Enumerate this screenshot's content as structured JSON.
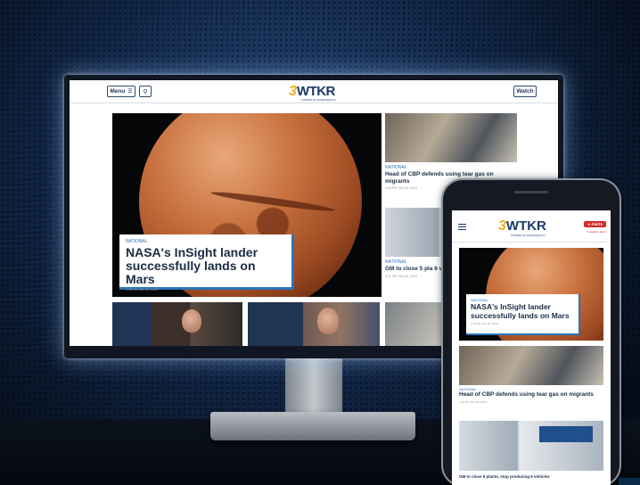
{
  "desktop": {
    "menu_label": "Menu",
    "watch_label": "Watch",
    "logo": {
      "number": "3",
      "text": "WTKR",
      "tagline": "COMING IN LAUNCHING IN"
    },
    "hero": {
      "category": "NATIONAL",
      "title": "NASA's InSight lander successfully lands on Mars",
      "meta": "2:46 PM, Nov 26, 2018"
    },
    "side_stories": [
      {
        "category": "NATIONAL",
        "title": "Head of CBP defends using tear gas on migrants",
        "meta": "4:43 PM, Nov 26, 2018"
      },
      {
        "category": "NATIONAL",
        "title": "GM to close 5 pla 6 vehicles",
        "meta": "4:41 PM, Nov 26, 2018"
      }
    ],
    "accent_color": "#2a74b8",
    "brand_color": "#1b3a6b"
  },
  "mobile": {
    "logo": {
      "number": "3",
      "text": "WTKR",
      "tagline": "COMING IN LAUNCHING IN"
    },
    "alert_label": "Alerts",
    "alert_sub": "3 weather alerts",
    "hero": {
      "category": "NATIONAL",
      "title": "NASA's InSight lander successfully lands on Mars",
      "meta": "2:46 PM, Nov 26, 2018"
    },
    "story2": {
      "category": "NATIONAL",
      "title": "Head of CBP defends using tear gas on migrants",
      "meta": "4:43 PM, Nov 26, 2018"
    },
    "story3_title": "GM to close 5 plants, stop producing 6 vehicles"
  }
}
